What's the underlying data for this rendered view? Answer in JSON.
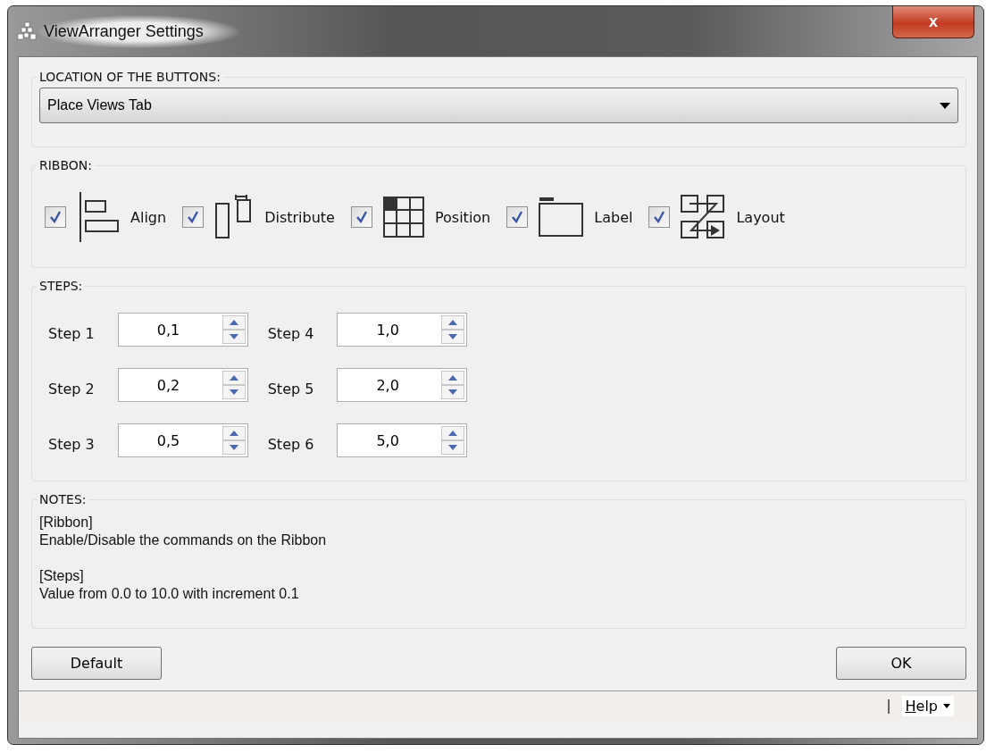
{
  "window": {
    "title": "ViewArranger Settings",
    "close": "x"
  },
  "location": {
    "legend": "LOCATION OF THE BUTTONS:",
    "value": "Place Views Tab"
  },
  "ribbon": {
    "legend": "RIBBON:",
    "items": [
      {
        "kind": "align",
        "label": "Align",
        "checked": true
      },
      {
        "kind": "distribute",
        "label": "Distribute",
        "checked": true
      },
      {
        "kind": "position",
        "label": "Position",
        "checked": true
      },
      {
        "kind": "label",
        "label": "Label",
        "checked": true
      },
      {
        "kind": "layout",
        "label": "Layout",
        "checked": true
      }
    ]
  },
  "steps": {
    "legend": "STEPS:",
    "items": [
      {
        "label": "Step 1",
        "value": "0,1"
      },
      {
        "label": "Step 2",
        "value": "0,2"
      },
      {
        "label": "Step 3",
        "value": "0,5"
      },
      {
        "label": "Step 4",
        "value": "1,0"
      },
      {
        "label": "Step 5",
        "value": "2,0"
      },
      {
        "label": "Step 6",
        "value": "5,0"
      }
    ]
  },
  "notes": {
    "legend": "NOTES:",
    "sections": [
      {
        "heading": "[Ribbon]",
        "text": "Enable/Disable the commands on the Ribbon"
      },
      {
        "heading": "[Steps]",
        "text": "Value from 0.0 to 10.0 with increment 0.1"
      }
    ]
  },
  "buttons": {
    "left": "Default",
    "right": "OK"
  },
  "status_bar": {
    "separator": "|",
    "help": "Help"
  }
}
